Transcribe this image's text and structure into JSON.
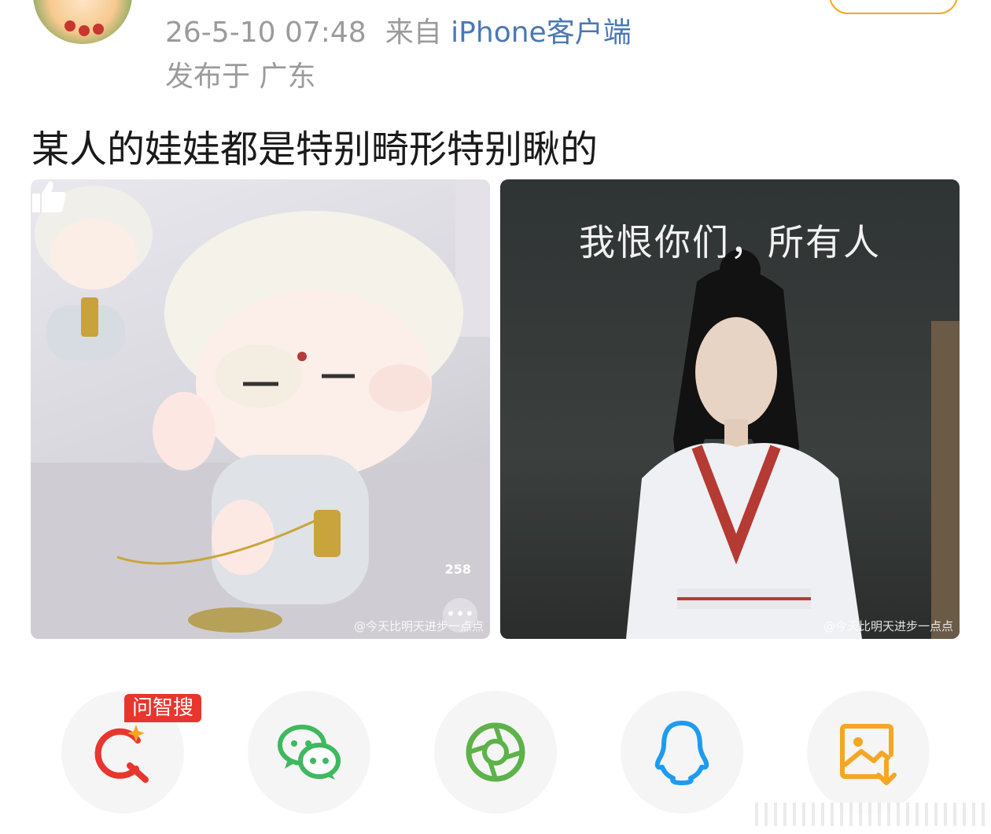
{
  "post": {
    "timestamp": "26-5-10 07:48",
    "source_prefix": "来自",
    "source_client": "iPhone客户端",
    "location": "发布于 广东",
    "text": "某人的娃娃都是特别畸形特别瞅的"
  },
  "images": [
    {
      "like_count": "258",
      "watermark": "@今天比明天进步一点点",
      "icons": [
        "thumbs-up-icon",
        "more-icon"
      ]
    },
    {
      "caption": "我恨你们，所有人",
      "watermark": "@今天比明天进步一点点"
    }
  ],
  "share_bar": {
    "badge": "问智搜",
    "buttons": [
      {
        "icon": "ai-search-icon",
        "color": "#e8352e"
      },
      {
        "icon": "wechat-icon",
        "color": "#3fb85f"
      },
      {
        "icon": "moments-icon",
        "color": "#5db24a"
      },
      {
        "icon": "qq-icon",
        "color": "#1e9bf0"
      },
      {
        "icon": "save-image-icon",
        "color": "#f5a623"
      }
    ]
  }
}
